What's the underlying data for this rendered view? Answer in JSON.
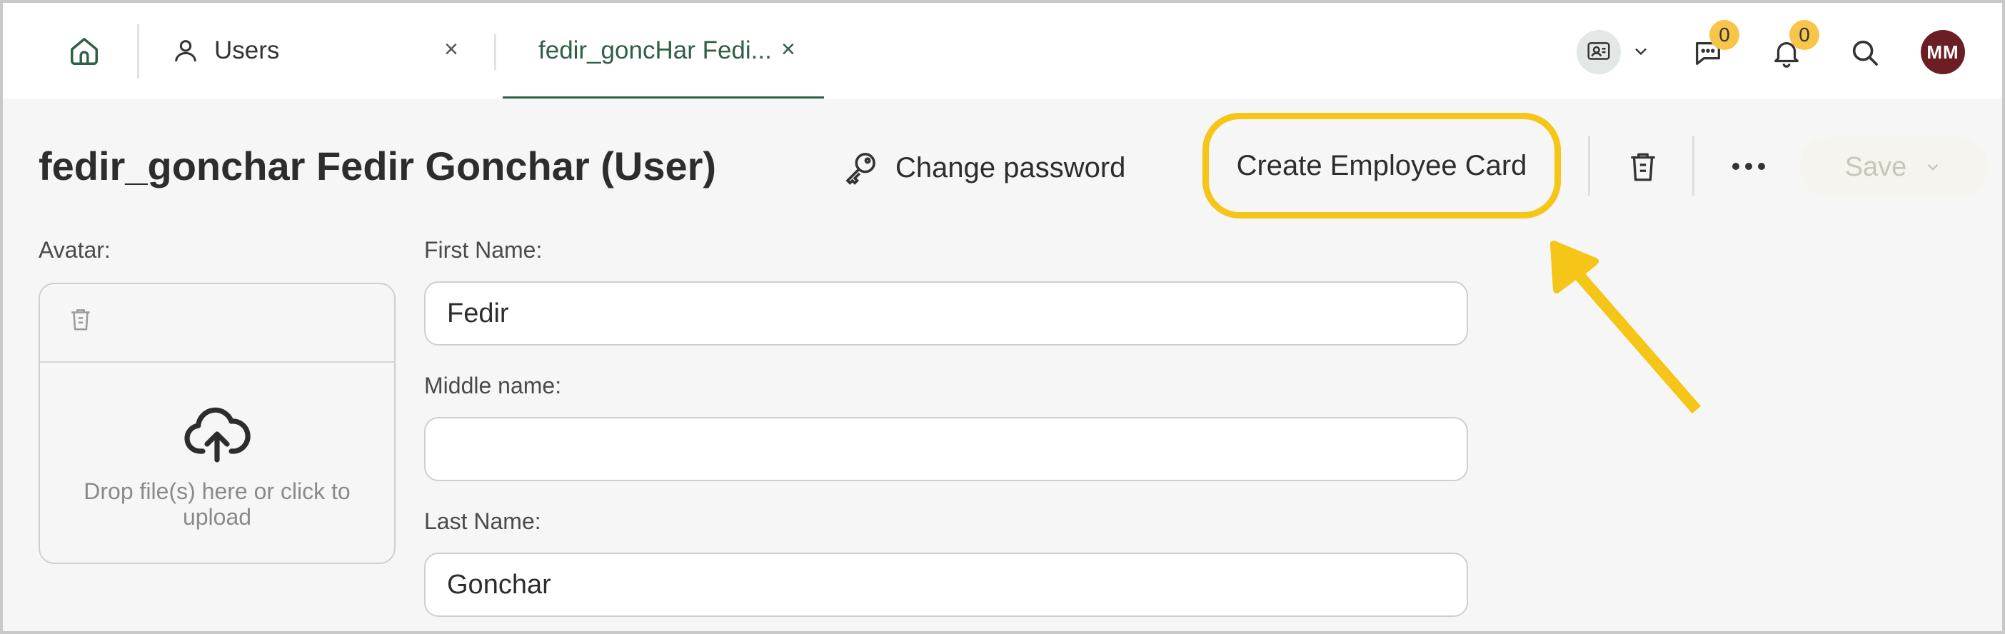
{
  "tabs": {
    "users_label": "Users",
    "user_label": "fedir_goncHar Fedi...",
    "close_glyph": "×"
  },
  "top": {
    "chat_count": "0",
    "notification_count": "0",
    "avatar_initials": "MM"
  },
  "header": {
    "title": "fedir_gonchar Fedir Gonchar (User)",
    "change_password": "Change password",
    "create_employee_card": "Create Employee Card",
    "save": "Save"
  },
  "form": {
    "avatar_label": "Avatar:",
    "upload_text": "Drop file(s) here or click to upload",
    "first_name_label": "First Name:",
    "first_name_value": "Fedir",
    "middle_name_label": "Middle name:",
    "middle_name_value": "",
    "last_name_label": "Last Name:",
    "last_name_value": "Gonchar"
  },
  "colors": {
    "accent_green": "#2f5f45",
    "highlight_yellow": "#f5c518",
    "badge_yellow": "#f6c54a",
    "avatar_bg": "#6b1f24"
  }
}
